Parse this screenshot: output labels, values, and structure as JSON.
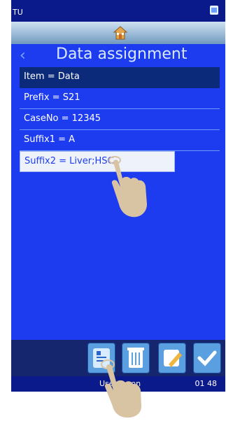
{
  "status_bar": {
    "left_text": "TU",
    "right_icon": "network-icon"
  },
  "header": {
    "home_icon": "home-icon",
    "back_icon": "chevron-left-icon",
    "title": "Data assignment"
  },
  "list": {
    "header": "Item = Data",
    "items": [
      {
        "label": "Prefix = S21"
      },
      {
        "label": "CaseNo = 12345"
      },
      {
        "label": "Suffix1 = A"
      },
      {
        "label": "Suffix2 = Liver;HSC",
        "selected": true
      }
    ]
  },
  "bottom_toolbar": {
    "buttons": [
      {
        "icon": "data-assign-icon"
      },
      {
        "icon": "trash-icon"
      },
      {
        "icon": "edit-icon"
      },
      {
        "icon": "check-icon"
      }
    ]
  },
  "footer": {
    "user": "User logon",
    "time": "01 48"
  }
}
